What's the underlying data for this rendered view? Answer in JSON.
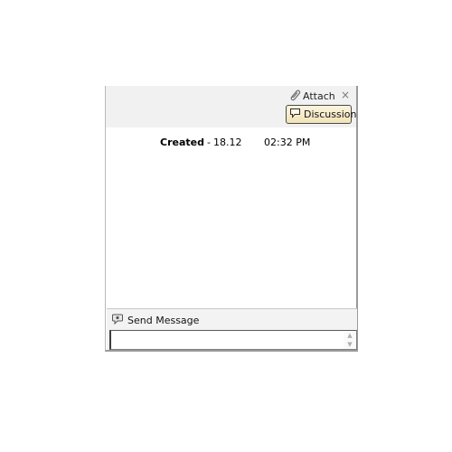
{
  "toolbar": {
    "attach_label": "Attach",
    "close_glyph": "×",
    "discussion_label": "Discussion",
    "icons": {
      "attach": "paperclip-icon",
      "close": "close-icon",
      "discussion": "speech-bubble-icon"
    }
  },
  "history": {
    "action": "Created",
    "separator": "-",
    "date": "18.12",
    "time": "02:32 PM"
  },
  "send_message": {
    "label": "Send Message",
    "icon": "chat-bubble-icon",
    "input_value": "",
    "scroll_up_glyph": "▲",
    "scroll_down_glyph": "▼"
  },
  "colors": {
    "discussion_button_bg": "#f2e4b8",
    "toolbar_bg": "#f1f1f1",
    "panel_border": "#9a9a9a"
  }
}
